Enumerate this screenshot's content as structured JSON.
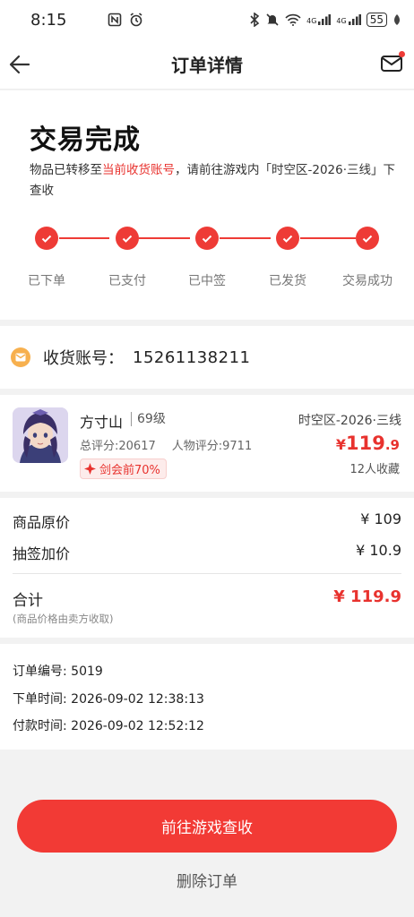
{
  "status_bar": {
    "time": "8:15",
    "left_icons": [
      "nfc-icon",
      "alarm-icon"
    ],
    "right_icons": [
      "bluetooth-icon",
      "mute-icon",
      "wifi-icon",
      "signal-icon",
      "signal-icon"
    ],
    "signal_label_1": "4G",
    "signal_label_2": "4G",
    "battery": "55"
  },
  "nav": {
    "title": "订单详情"
  },
  "status": {
    "headline": "交易完成",
    "desc_prefix": "物品已转移至",
    "desc_highlight": "当前收货账号",
    "desc_suffix": "，请前往游戏内「时空区-2026·三线」下查收",
    "accent": "#ee3b36",
    "steps": [
      "已下单",
      "已支付",
      "已中签",
      "已发货",
      "交易成功"
    ]
  },
  "account": {
    "label": "收货账号：",
    "value": "15261138211"
  },
  "item": {
    "name": "方寸山",
    "level": "69级",
    "total_score": "总评分:20617",
    "role_score": "人物评分:9711",
    "tag": "剑会前70%",
    "server": "时空区-2026·三线",
    "price_symbol": "¥",
    "price_int": "119",
    "price_dec": ".9",
    "favorites": "12人收藏"
  },
  "pricing": {
    "original_label": "商品原价",
    "original_value": "¥ 109",
    "draw_label": "抽签加价",
    "draw_value": "¥ 10.9",
    "total_label": "合计",
    "total_note": "(商品价格由卖方收取)",
    "total_value": "¥ 119.9"
  },
  "order": {
    "number": "订单编号: 5019",
    "created": "下单时间: 2026-09-02 12:38:13",
    "paid": "付款时间: 2026-09-02 12:52:12"
  },
  "actions": {
    "primary": "前往游戏查收",
    "delete": "删除订单"
  }
}
